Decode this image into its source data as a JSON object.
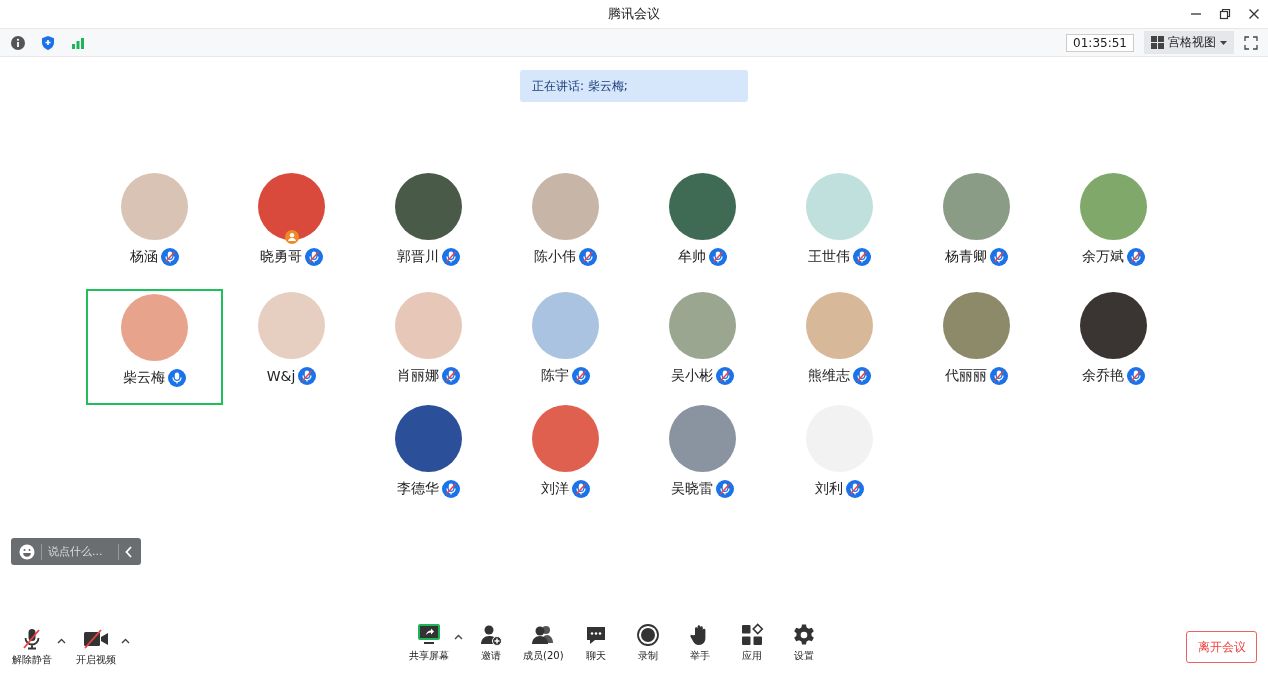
{
  "window": {
    "title": "腾讯会议"
  },
  "toolbar": {
    "timer": "01:35:51",
    "view_mode": "宫格视图"
  },
  "speaking_banner": "正在讲话: 柴云梅;",
  "participant_rows": [
    [
      {
        "name": "杨涵",
        "muted": true,
        "selected": false,
        "host": false
      },
      {
        "name": "晓勇哥",
        "muted": true,
        "selected": false,
        "host": true
      },
      {
        "name": "郭晋川",
        "muted": true,
        "selected": false,
        "host": false
      },
      {
        "name": "陈小伟",
        "muted": true,
        "selected": false,
        "host": false
      },
      {
        "name": "牟帅",
        "muted": true,
        "selected": false,
        "host": false
      },
      {
        "name": "王世伟",
        "muted": true,
        "selected": false,
        "host": false
      },
      {
        "name": "杨青卿",
        "muted": true,
        "selected": false,
        "host": false
      },
      {
        "name": "余万斌",
        "muted": true,
        "selected": false,
        "host": false
      }
    ],
    [
      {
        "name": "柴云梅",
        "muted": false,
        "selected": true,
        "host": false
      },
      {
        "name": "W&j",
        "muted": true,
        "selected": false,
        "host": false
      },
      {
        "name": "肖丽娜",
        "muted": true,
        "selected": false,
        "host": false
      },
      {
        "name": "陈宇",
        "muted": true,
        "selected": false,
        "host": false
      },
      {
        "name": "吴小彬",
        "muted": true,
        "selected": false,
        "host": false
      },
      {
        "name": "熊维志",
        "muted": true,
        "selected": false,
        "host": false
      },
      {
        "name": "代丽丽",
        "muted": true,
        "selected": false,
        "host": false
      },
      {
        "name": "余乔艳",
        "muted": true,
        "selected": false,
        "host": false
      }
    ],
    [
      {
        "name": "李德华",
        "muted": true,
        "selected": false,
        "host": false
      },
      {
        "name": "刘洋",
        "muted": true,
        "selected": false,
        "host": false
      },
      {
        "name": "吴晓雷",
        "muted": true,
        "selected": false,
        "host": false
      },
      {
        "name": "刘利",
        "muted": true,
        "selected": false,
        "host": false
      }
    ]
  ],
  "chat": {
    "placeholder": "说点什么..."
  },
  "bottom_left": [
    {
      "kind": "mic",
      "label": "解除静音"
    },
    {
      "kind": "video",
      "label": "开启视频"
    }
  ],
  "bottom_center": [
    {
      "kind": "share",
      "label": "共享屏幕"
    },
    {
      "kind": "invite",
      "label": "邀请"
    },
    {
      "kind": "members",
      "label": "成员(20)"
    },
    {
      "kind": "chat",
      "label": "聊天"
    },
    {
      "kind": "record",
      "label": "录制"
    },
    {
      "kind": "hand",
      "label": "举手"
    },
    {
      "kind": "apps",
      "label": "应用"
    },
    {
      "kind": "settings",
      "label": "设置"
    }
  ],
  "leave_button": "离开会议"
}
